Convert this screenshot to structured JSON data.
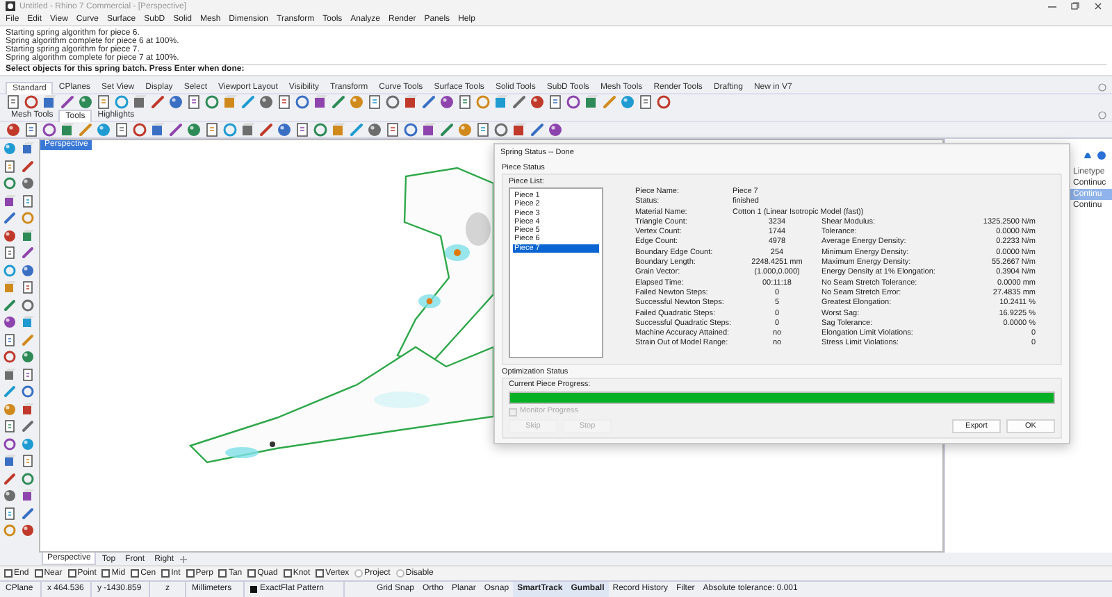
{
  "window": {
    "title": "Untitled - Rhino 7 Commercial - [Perspective]"
  },
  "menu": [
    "File",
    "Edit",
    "View",
    "Curve",
    "Surface",
    "SubD",
    "Solid",
    "Mesh",
    "Dimension",
    "Transform",
    "Tools",
    "Analyze",
    "Render",
    "Panels",
    "Help"
  ],
  "command_history": [
    "Starting spring algorithm for piece 6.",
    "Spring algorithm complete for piece 6 at 100%.",
    "Starting spring algorithm for piece 7.",
    "Spring algorithm complete for piece 7 at 100%."
  ],
  "command_prompt": "Select objects for this spring batch. Press Enter when done:",
  "toolbar_tabs": [
    {
      "label": "Standard",
      "selected": true
    },
    {
      "label": "CPlanes",
      "selected": false
    },
    {
      "label": "Set View",
      "selected": false
    },
    {
      "label": "Display",
      "selected": false
    },
    {
      "label": "Select",
      "selected": false
    },
    {
      "label": "Viewport Layout",
      "selected": false
    },
    {
      "label": "Visibility",
      "selected": false
    },
    {
      "label": "Transform",
      "selected": false
    },
    {
      "label": "Curve Tools",
      "selected": false
    },
    {
      "label": "Surface Tools",
      "selected": false
    },
    {
      "label": "Solid Tools",
      "selected": false
    },
    {
      "label": "SubD Tools",
      "selected": false
    },
    {
      "label": "Mesh Tools",
      "selected": false
    },
    {
      "label": "Render Tools",
      "selected": false
    },
    {
      "label": "Drafting",
      "selected": false
    },
    {
      "label": "New in V7",
      "selected": false
    }
  ],
  "sub_toolbar_tabs": [
    {
      "label": "Mesh Tools",
      "selected": false
    },
    {
      "label": "Tools",
      "selected": true
    },
    {
      "label": "Highlights",
      "selected": false
    }
  ],
  "viewport": {
    "title": "Perspective",
    "tabs": [
      {
        "label": "Perspective",
        "selected": true
      },
      {
        "label": "Top",
        "selected": false
      },
      {
        "label": "Front",
        "selected": false
      },
      {
        "label": "Right",
        "selected": false
      }
    ]
  },
  "layers_panel": {
    "header": "Linetype",
    "rows": [
      {
        "text": "Continuc",
        "selected": false
      },
      {
        "text": "Continu",
        "selected": true
      },
      {
        "text": "Continu",
        "selected": false
      }
    ]
  },
  "dialog": {
    "title": "Spring Status -- Done",
    "piece_status_label": "Piece Status",
    "piece_list_label": "Piece List:",
    "pieces": [
      {
        "label": "Piece 1",
        "selected": false
      },
      {
        "label": "Piece 2",
        "selected": false
      },
      {
        "label": "Piece 3",
        "selected": false
      },
      {
        "label": "Piece 4",
        "selected": false
      },
      {
        "label": "Piece 5",
        "selected": false
      },
      {
        "label": "Piece 6",
        "selected": false
      },
      {
        "label": "Piece 7",
        "selected": true
      }
    ],
    "summary": [
      {
        "label": "Piece Name:",
        "value": "Piece 7"
      },
      {
        "label": "Status:",
        "value": "finished"
      },
      {
        "label": "Material Name:",
        "value": "Cotton 1 (Linear Isotropic Model (fast))"
      }
    ],
    "left_stats": [
      {
        "label": "Triangle Count:",
        "value": "3234"
      },
      {
        "label": "Vertex Count:",
        "value": "1744"
      },
      {
        "label": "Edge Count:",
        "value": "4978"
      },
      {
        "label": "Boundary Edge Count:",
        "value": "254"
      },
      {
        "label": "Boundary Length:",
        "value": "2248.4251 mm"
      },
      {
        "label": "Grain Vector:",
        "value": "(1.000,0.000)"
      },
      {
        "label": "Elapsed Time:",
        "value": "00:11:18"
      },
      {
        "label": "Failed Newton Steps:",
        "value": "0"
      },
      {
        "label": "Successful Newton Steps:",
        "value": "5"
      },
      {
        "label": "Failed Quadratic Steps:",
        "value": "0"
      },
      {
        "label": "Successful Quadratic Steps:",
        "value": "0"
      },
      {
        "label": "Machine Accuracy Attained:",
        "value": "no"
      },
      {
        "label": "Strain Out of Model Range:",
        "value": "no"
      }
    ],
    "right_stats": [
      {
        "label": "Shear Modulus:",
        "value": "1325.2500 N/m"
      },
      {
        "label": "Tolerance:",
        "value": "0.0000 N/m"
      },
      {
        "label": "Average Energy Density:",
        "value": "0.2233 N/m"
      },
      {
        "label": "Minimum Energy Density:",
        "value": "0.0000 N/m"
      },
      {
        "label": "Maximum Energy Density:",
        "value": "55.2667 N/m"
      },
      {
        "label": "Energy Density at 1% Elongation:",
        "value": "0.3904 N/m"
      },
      {
        "label": "No Seam Stretch Tolerance:",
        "value": "0.0000 mm"
      },
      {
        "label": "No Seam Stretch Error:",
        "value": "27.4835 mm"
      },
      {
        "label": "Greatest Elongation:",
        "value": "10.2411 %"
      },
      {
        "label": "Worst Sag:",
        "value": "16.9225 %"
      },
      {
        "label": "Sag Tolerance:",
        "value": "0.0000 %"
      },
      {
        "label": "Elongation Limit Violations:",
        "value": "0"
      },
      {
        "label": "Stress Limit Violations:",
        "value": "0"
      }
    ],
    "optimization_label": "Optimization Status",
    "progress_label": "Current Piece Progress:",
    "progress": {
      "level": 1
    },
    "monitor_progress": {
      "label": "Monitor Progress",
      "checked": false,
      "disabled": true
    },
    "buttons": [
      {
        "label": "Skip",
        "disabled": true
      },
      {
        "label": "Stop",
        "disabled": true
      },
      {
        "label": "Export",
        "disabled": false
      },
      {
        "label": "OK",
        "disabled": false
      }
    ]
  },
  "osnaps": [
    {
      "label": "End",
      "kind": "checkbox",
      "checked": false
    },
    {
      "label": "Near",
      "kind": "checkbox",
      "checked": false
    },
    {
      "label": "Point",
      "kind": "checkbox",
      "checked": false
    },
    {
      "label": "Mid",
      "kind": "checkbox",
      "checked": false
    },
    {
      "label": "Cen",
      "kind": "checkbox",
      "checked": false
    },
    {
      "label": "Int",
      "kind": "checkbox",
      "checked": false
    },
    {
      "label": "Perp",
      "kind": "checkbox",
      "checked": false
    },
    {
      "label": "Tan",
      "kind": "checkbox",
      "checked": false
    },
    {
      "label": "Quad",
      "kind": "checkbox",
      "checked": false
    },
    {
      "label": "Knot",
      "kind": "checkbox",
      "checked": false
    },
    {
      "label": "Vertex",
      "kind": "checkbox",
      "checked": false
    },
    {
      "label": "Project",
      "kind": "radio",
      "checked": false
    },
    {
      "label": "Disable",
      "kind": "radio",
      "checked": false
    }
  ],
  "status_bar": {
    "cplane": "CPlane",
    "x": "x 464.536",
    "y": "y -1430.859",
    "z": "z",
    "units": "Millimeters",
    "layer": "ExactFlat Pattern",
    "toggles": [
      {
        "label": "Grid Snap",
        "on": false
      },
      {
        "label": "Ortho",
        "on": false
      },
      {
        "label": "Planar",
        "on": false
      },
      {
        "label": "Osnap",
        "on": false
      },
      {
        "label": "SmartTrack",
        "on": true
      },
      {
        "label": "Gumball",
        "on": true
      },
      {
        "label": "Record History",
        "on": false
      },
      {
        "label": "Filter",
        "on": false
      }
    ],
    "tolerance": "Absolute tolerance: 0.001"
  }
}
